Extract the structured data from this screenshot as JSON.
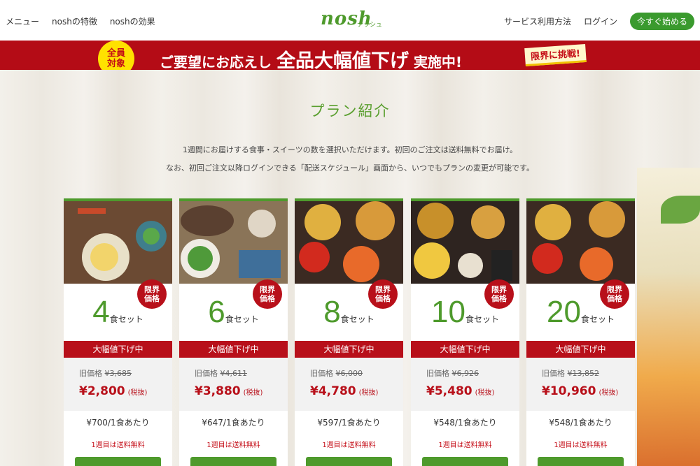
{
  "header": {
    "nav_left": [
      "メニュー",
      "noshの特徴",
      "noshの効果"
    ],
    "logo": "nosh",
    "logo_sub": "ナッシュ",
    "nav_right": [
      "サービス利用方法",
      "ログイン"
    ],
    "start_button": "今すぐ始める"
  },
  "banner": {
    "badge_line1": "全員",
    "badge_line2": "対象",
    "text_pre": "ご要望にお応えし",
    "text_big": "全品大幅値下げ",
    "text_post": "実施中!",
    "limit_tag": "限界に挑戦!"
  },
  "section": {
    "title": "プラン紹介",
    "desc1": "1週間にお届けする食事・スイーツの数を選択いただけます。初回のご注文は送料無料でお届け。",
    "desc2": "なお、初回ご注文以降ログインできる「配送スケジュール」画面から、いつでもプランの変更が可能です。"
  },
  "plans": [
    {
      "count": "4",
      "unit": "食セット",
      "badge1": "限界",
      "badge2": "価格",
      "discount": "大幅値下げ中",
      "old_label": "旧価格",
      "old_price": "¥3,685",
      "price": "¥2,800",
      "tax": "(税抜)",
      "per_meal": "¥700/1食あたり",
      "shipping": "1週目は送料無料"
    },
    {
      "count": "6",
      "unit": "食セット",
      "badge1": "限界",
      "badge2": "価格",
      "discount": "大幅値下げ中",
      "old_label": "旧価格",
      "old_price": "¥4,611",
      "price": "¥3,880",
      "tax": "(税抜)",
      "per_meal": "¥647/1食あたり",
      "shipping": "1週目は送料無料"
    },
    {
      "count": "8",
      "unit": "食セット",
      "badge1": "限界",
      "badge2": "価格",
      "discount": "大幅値下げ中",
      "old_label": "旧価格",
      "old_price": "¥6,000",
      "price": "¥4,780",
      "tax": "(税抜)",
      "per_meal": "¥597/1食あたり",
      "shipping": "1週目は送料無料"
    },
    {
      "count": "10",
      "unit": "食セット",
      "badge1": "限界",
      "badge2": "価格",
      "discount": "大幅値下げ中",
      "old_label": "旧価格",
      "old_price": "¥6,926",
      "price": "¥5,480",
      "tax": "(税抜)",
      "per_meal": "¥548/1食あたり",
      "shipping": "1週目は送料無料"
    },
    {
      "count": "20",
      "unit": "食セット",
      "badge1": "限界",
      "badge2": "価格",
      "discount": "大幅値下げ中",
      "old_label": "旧価格",
      "old_price": "¥13,852",
      "price": "¥10,960",
      "tax": "(税抜)",
      "per_meal": "¥548/1食あたり",
      "shipping": "1週目は送料無料"
    }
  ],
  "colors": {
    "brand_green": "#4e9a2c",
    "accent_red": "#b8101a",
    "badge_yellow": "#ffe100"
  }
}
